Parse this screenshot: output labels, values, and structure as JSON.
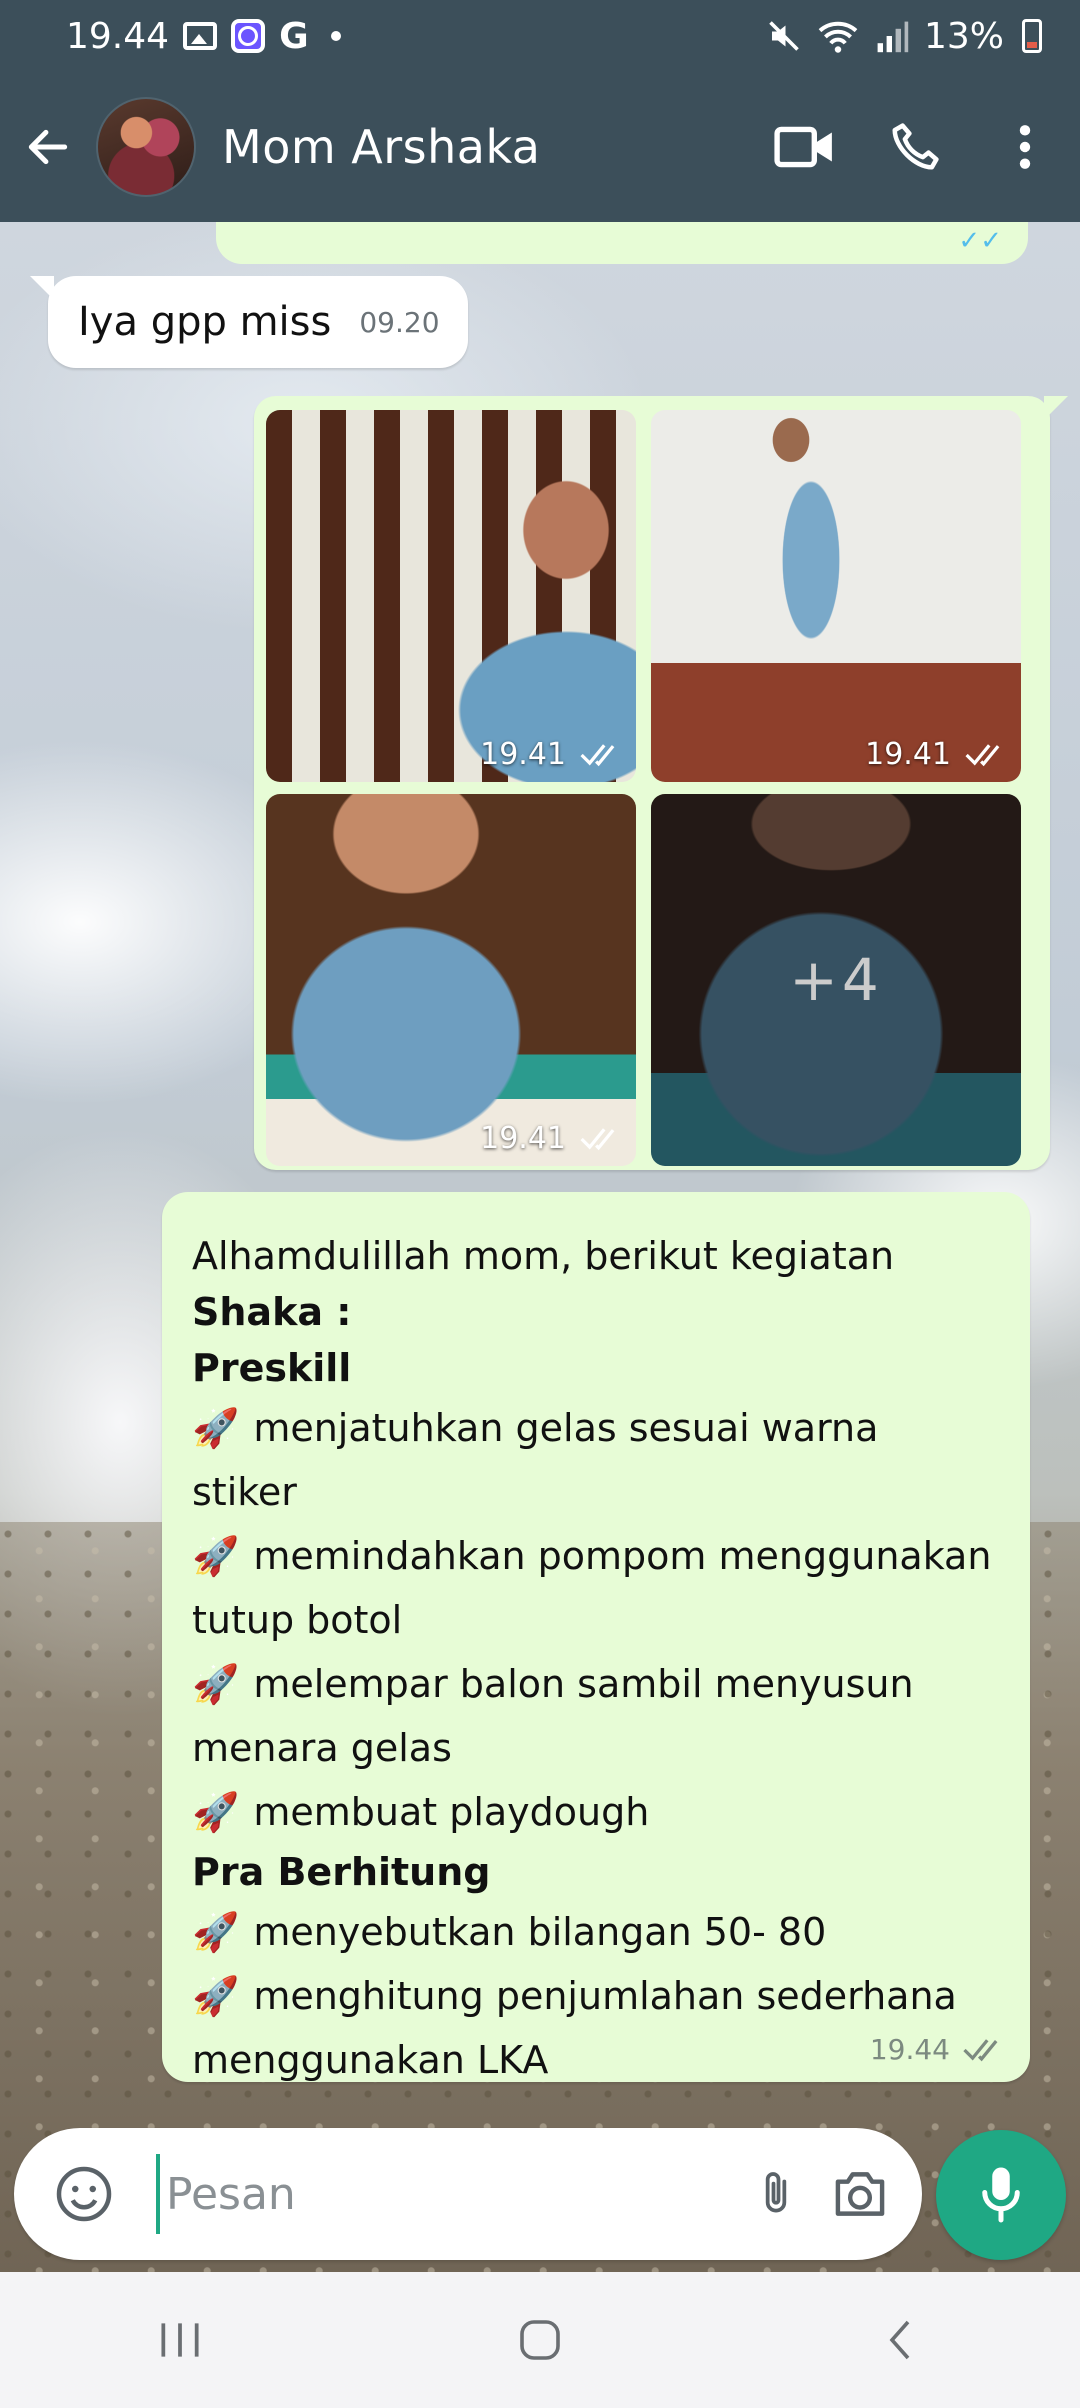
{
  "status_bar": {
    "time": "19.44",
    "g_label": "G",
    "battery": "13%"
  },
  "header": {
    "contact_name": "Mom Arshaka"
  },
  "chat": {
    "incoming": {
      "text": "Iya gpp miss",
      "time": "09.20"
    },
    "photos": [
      {
        "time": "19.41"
      },
      {
        "time": "19.41"
      },
      {
        "time": "19.41"
      },
      {
        "more_count": "+4"
      }
    ],
    "outgoing": {
      "lines": [
        "Alhamdulillah mom, berikut kegiatan",
        "Shaka :",
        "Preskill",
        "menjatuhkan gelas sesuai warna",
        "stiker",
        "memindahkan pompom menggunakan",
        "tutup botol",
        "melempar balon sambil menyusun",
        "menara gelas",
        "membuat playdough",
        "Pra Berhitung",
        "menyebutkan bilangan 50- 80",
        "menghitung penjumlahan sederhana",
        "menggunakan LKA"
      ],
      "rocket": "🚀",
      "time": "19.44"
    }
  },
  "input": {
    "placeholder": "Pesan"
  },
  "colors": {
    "header_bg": "#3c4f5a",
    "outgoing_bubble": "#e7fcd6",
    "accent": "#1fa884",
    "read_ticks": "#53bdeb"
  },
  "icons": [
    "back-arrow-icon",
    "video-call-icon",
    "phone-icon",
    "more-vert-icon",
    "emoji-icon",
    "attach-icon",
    "camera-icon",
    "mic-icon",
    "double-check-icon",
    "recents-icon",
    "home-icon",
    "nav-back-icon"
  ]
}
